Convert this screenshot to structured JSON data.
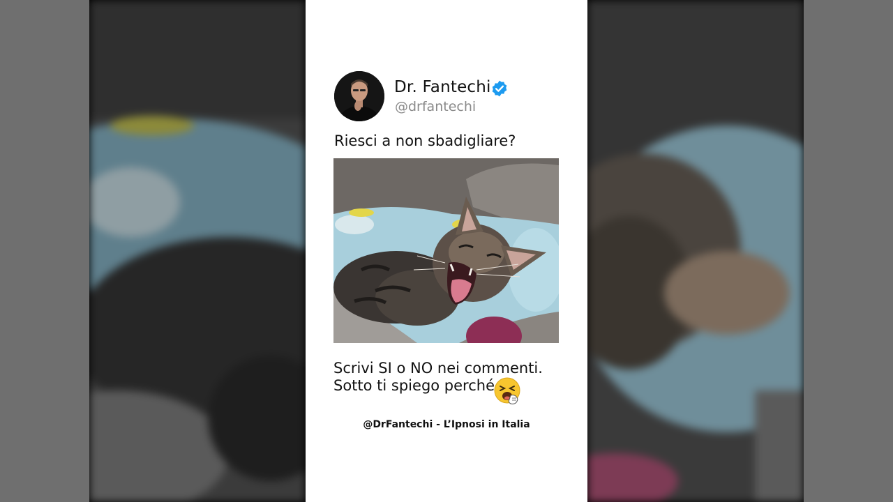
{
  "post": {
    "author_name": "Dr. Fantechi",
    "author_handle": "@drfantechi",
    "verified_icon": "verified-badge-icon",
    "question": "Riesci a non sbadigliare?",
    "image_description_icon": "yawning-kitten-photo",
    "cta_line1": "Scrivi SI o NO nei commenti.",
    "cta_line2": "Sotto ti spiego perché.",
    "emoji_icon": "yawning-face-emoji",
    "footer": "@DrFantechi - L’Ipnosi in Italia"
  },
  "colors": {
    "card_bg": "#ffffff",
    "verified_blue": "#1d9bf0",
    "handle_gray": "#8a8a8a",
    "pillar_gray": "#6f6f6f"
  }
}
